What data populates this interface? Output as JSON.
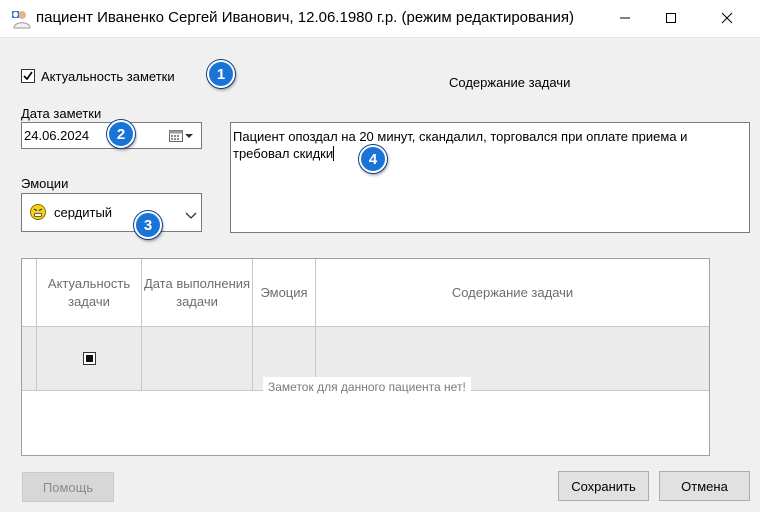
{
  "window": {
    "title": "пациент Иваненко Сергей Иванович, 12.06.1980 г.р. (режим редактирования)",
    "minimize_glyph": "—",
    "maximize_glyph": "☐",
    "close_glyph": "✕"
  },
  "form": {
    "actual_checkbox_label": "Актуальность заметки",
    "actual_checked": true,
    "date_label": "Дата заметки",
    "date_value": "24.06.2024",
    "emotion_label": "Эмоции",
    "emotion_value": "сердитый",
    "content_label": "Содержание задачи",
    "content_value": "Пациент опоздал на 20 минут, скандалил, торговался при оплате приема и требовал скидки"
  },
  "badges": [
    "1",
    "2",
    "3",
    "4"
  ],
  "grid": {
    "columns": [
      "Актуальность задачи",
      "Дата выполнения задачи",
      "Эмоция",
      "Содержание задачи"
    ],
    "empty_message": "Заметок для данного пациента нет!"
  },
  "buttons": {
    "help": "Помощь",
    "save": "Сохранить",
    "cancel": "Отмена"
  },
  "colors": {
    "badge": "#1a73d6",
    "window_bg": "#f0f0f0"
  },
  "icons": [
    "patient-app-icon",
    "calendar-icon",
    "chevron-down-icon",
    "angry-face-icon",
    "minimize-icon",
    "maximize-icon",
    "close-icon"
  ]
}
